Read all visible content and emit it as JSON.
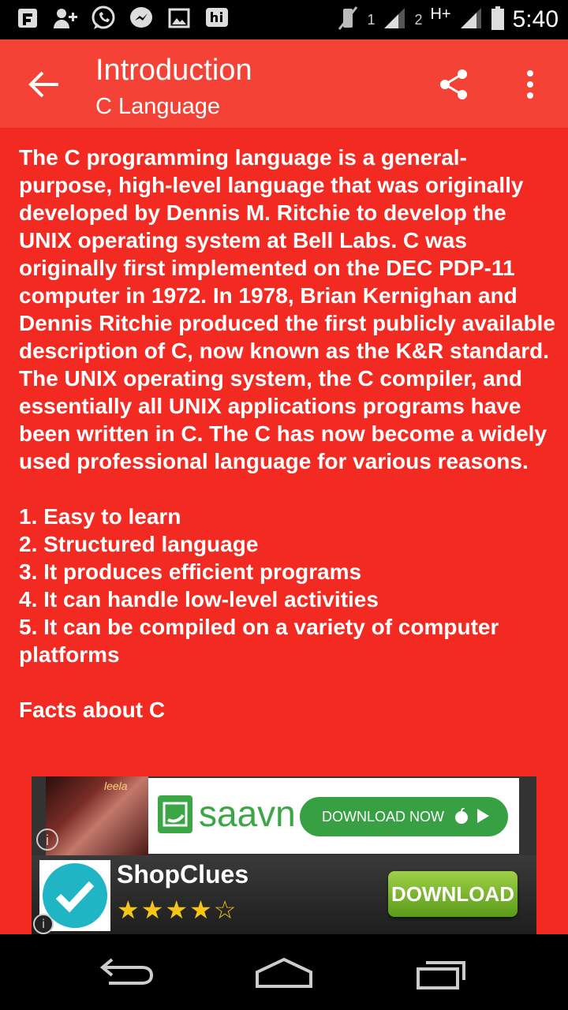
{
  "status_bar": {
    "time": "5:40",
    "sim1_label": "1",
    "sim2_label": "2",
    "network_type": "H+",
    "notification_icons": [
      "shield-icon",
      "add-contact-icon",
      "whatsapp-icon",
      "messenger-icon",
      "gallery-icon",
      "hike-icon"
    ]
  },
  "app_bar": {
    "title": "Introduction",
    "subtitle": "C Language"
  },
  "content": {
    "paragraph": "The C programming language is a general-purpose, high-level language that was originally developed by Dennis M. Ritchie to develop the UNIX operating system at Bell Labs. C was originally first implemented on the DEC PDP-11 computer in 1972. In 1978, Brian Kernighan and Dennis Ritchie produced the first publicly available description of C, now known as the K&R standard. The UNIX operating system, the C compiler, and essentially all UNIX applications programs have been written in C. The C has now become a widely used professional language for various reasons.",
    "reasons": [
      "1. Easy to learn",
      "2. Structured language",
      "3. It produces efficient programs",
      "4. It can handle low-level activities",
      "5. It can be compiled on a variety of computer platforms"
    ],
    "facts_heading": "Facts about C"
  },
  "ads": {
    "saavn": {
      "brand": "saavn",
      "button_label": "DOWNLOAD NOW",
      "thumb_text": "leela",
      "info_label": "i"
    },
    "shopclues": {
      "app_name": "ShopClues",
      "rating": 4,
      "rating_max": 5,
      "stars_text": "★★★★☆",
      "button_label": "DOWNLOAD",
      "info_label": "i"
    }
  },
  "colors": {
    "app_bar": "#f44336",
    "content_bg": "#f22a22",
    "text": "#ffffff",
    "saavn_green": "#3aa744"
  }
}
